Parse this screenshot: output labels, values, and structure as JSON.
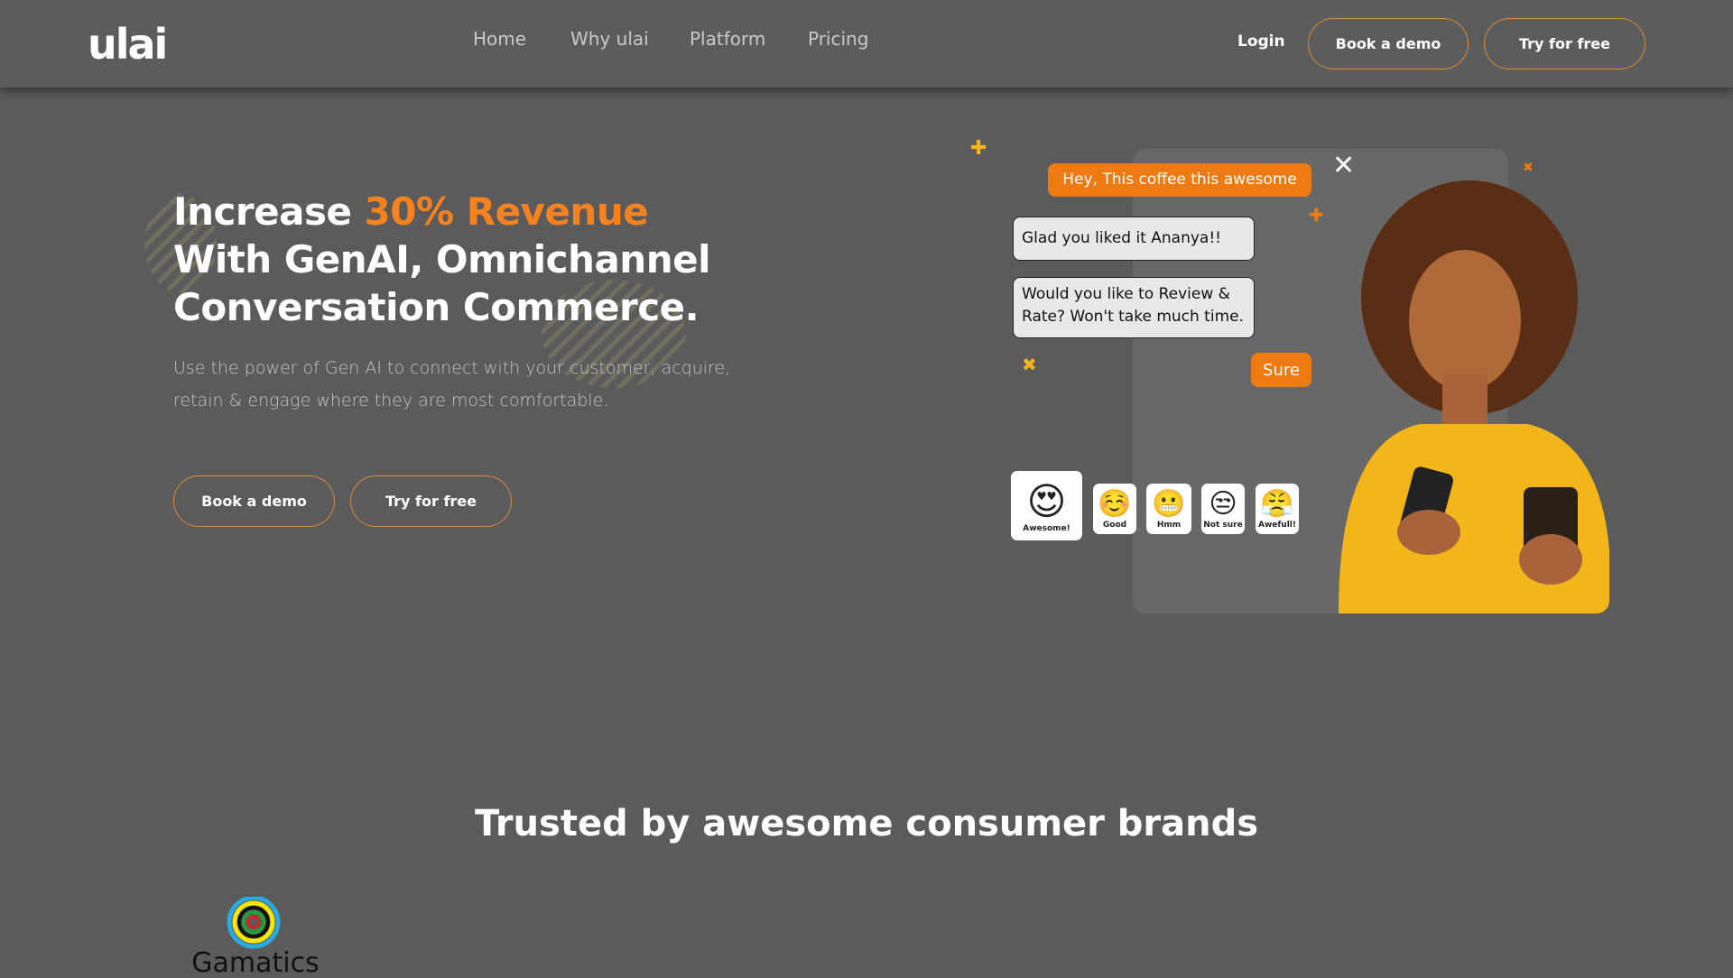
{
  "nav": {
    "logo": "ulai",
    "links": [
      "Home",
      "Why ulai",
      "Platform",
      "Pricing"
    ],
    "login": "Login",
    "book_demo": "Book a demo",
    "try_free": "Try for free"
  },
  "hero": {
    "title_prefix": "Increase ",
    "title_highlight": "30% Revenue",
    "title_line2": "With GenAI, Omnichannel",
    "title_line3": "Conversation Commerce.",
    "subtitle": "Use the power of Gen AI to connect with your customer, acquire, retain & engage where they are most comfortable.",
    "book_demo": "Book a demo",
    "try_free": "Try for free"
  },
  "chat": {
    "msg1": "Hey, This coffee this awesome",
    "msg2": "Glad you liked it Ananya!!",
    "msg3": "Would you like to Review & Rate? Won't take much time.",
    "msg4": "Sure",
    "ratings": [
      {
        "emoji": "😍",
        "label": "Awesome!"
      },
      {
        "emoji": "☺️",
        "label": "Good"
      },
      {
        "emoji": "😬",
        "label": "Hmm"
      },
      {
        "emoji": "😒",
        "label": "Not sure"
      },
      {
        "emoji": "😤",
        "label": "Awefull!"
      }
    ]
  },
  "trusted": {
    "title": "Trusted by awesome consumer brands",
    "brands": [
      "Gamatics"
    ]
  },
  "colors": {
    "accent": "#f5821f",
    "background": "#5b5b5b",
    "button_border": "#d98a3a"
  }
}
